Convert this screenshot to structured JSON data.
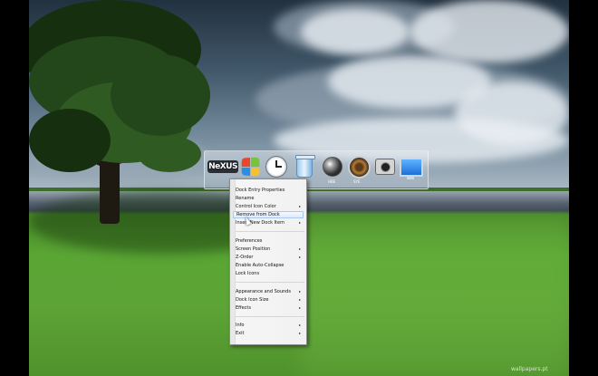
{
  "dock": {
    "items": [
      {
        "icon": "nexus-logo-icon",
        "text": "NeXUS"
      },
      {
        "icon": "windows-logo-icon"
      },
      {
        "icon": "clock-icon"
      },
      {
        "icon": "recycle-bin-icon"
      },
      {
        "icon": "media-orb-icon",
        "caption": "HBE"
      },
      {
        "icon": "gear-orb-icon",
        "caption": "SYE"
      },
      {
        "icon": "camera-icon"
      },
      {
        "icon": "monitor-icon"
      }
    ]
  },
  "context_menu": {
    "items": [
      {
        "label": "Dock Entry Properties",
        "submenu": false
      },
      {
        "label": "Rename",
        "submenu": false
      },
      {
        "label": "Control Icon Color",
        "submenu": true
      },
      {
        "label": "Remove from Dock",
        "submenu": false,
        "hover": true
      },
      {
        "label": "Insert New Dock Item",
        "submenu": true
      },
      {
        "label": "Preferences",
        "submenu": false
      },
      {
        "label": "Screen Position",
        "submenu": true
      },
      {
        "label": "Z-Order",
        "submenu": true
      },
      {
        "label": "Enable Auto-Collapse",
        "submenu": false
      },
      {
        "label": "Lock Icons",
        "submenu": false
      },
      {
        "label": "Appearance and Sounds",
        "submenu": true
      },
      {
        "label": "Dock Icon Size",
        "submenu": true
      },
      {
        "label": "Effects",
        "submenu": true
      },
      {
        "label": "Info",
        "submenu": true
      },
      {
        "label": "Exit",
        "submenu": true
      }
    ],
    "arrow_glyph": "▸"
  },
  "watermark": "wallpapers.pt",
  "colors": {
    "menu_hover_border": "#a8c9ee",
    "grass": "#5aa634",
    "sky": "#6e8597"
  }
}
